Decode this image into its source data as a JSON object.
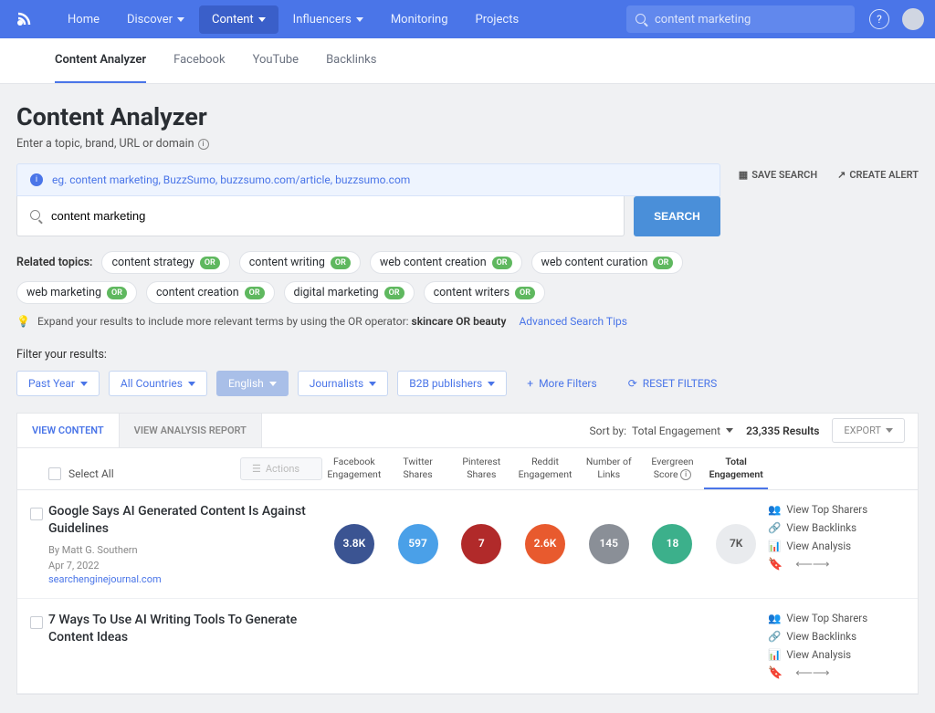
{
  "nav": {
    "items": [
      {
        "label": "Home",
        "dropdown": false
      },
      {
        "label": "Discover",
        "dropdown": true
      },
      {
        "label": "Content",
        "dropdown": true,
        "active": true
      },
      {
        "label": "Influencers",
        "dropdown": true
      },
      {
        "label": "Monitoring",
        "dropdown": false
      },
      {
        "label": "Projects",
        "dropdown": false
      }
    ],
    "search_value": "content marketing"
  },
  "subtabs": [
    "Content Analyzer",
    "Facebook",
    "YouTube",
    "Backlinks"
  ],
  "page": {
    "title": "Content Analyzer",
    "subtitle": "Enter a topic, brand, URL or domain",
    "hint": "eg. content marketing, BuzzSumo, buzzsumo.com/article, buzzsumo.com",
    "search_value": "content marketing",
    "search_button": "SEARCH",
    "save_search": "SAVE SEARCH",
    "create_alert": "CREATE ALERT"
  },
  "related": {
    "label": "Related topics:",
    "row1": [
      "content strategy",
      "content writing",
      "web content creation",
      "web content curation"
    ],
    "row2": [
      "web marketing",
      "content creation",
      "digital marketing",
      "content writers"
    ]
  },
  "tip": {
    "text_before": "Expand your results to include more relevant terms by using the OR operator:",
    "example": "skincare OR beauty",
    "link": "Advanced Search Tips"
  },
  "filters": {
    "label": "Filter your results:",
    "pills": [
      "Past Year",
      "All Countries",
      "English",
      "Journalists",
      "B2B publishers"
    ],
    "more": "More Filters",
    "reset": "RESET FILTERS"
  },
  "results": {
    "tabs": [
      "VIEW CONTENT",
      "VIEW ANALYSIS REPORT"
    ],
    "sort_label": "Sort by:",
    "sort_value": "Total Engagement",
    "count": "23,335",
    "count_suffix": "Results",
    "export": "EXPORT",
    "select_all": "Select All",
    "actions": "Actions",
    "columns": [
      "Facebook Engagement",
      "Twitter Shares",
      "Pinterest Shares",
      "Reddit Engagement",
      "Number of Links",
      "Evergreen Score",
      "Total Engagement"
    ],
    "rows": [
      {
        "title": "Google Says AI Generated Content Is Against Guidelines",
        "byline": "By  Matt G. Southern",
        "date": "Apr 7, 2022",
        "domain": "searchenginejournal.com",
        "metrics": [
          {
            "value": "3.8K",
            "color": "#3b5492"
          },
          {
            "value": "597",
            "color": "#4aa0e8"
          },
          {
            "value": "7",
            "color": "#b12a2a"
          },
          {
            "value": "2.6K",
            "color": "#e85a2e"
          },
          {
            "value": "145",
            "color": "#8a8f97"
          },
          {
            "value": "18",
            "color": "#3cb08b"
          },
          {
            "value": "7K",
            "color": "#e9ebee",
            "text": "#555"
          }
        ]
      },
      {
        "title": "7 Ways To Use AI Writing Tools To Generate Content Ideas",
        "byline": "",
        "date": "",
        "domain": "",
        "metrics": []
      }
    ],
    "side_links": [
      "View Top Sharers",
      "View Backlinks",
      "View Analysis"
    ]
  }
}
